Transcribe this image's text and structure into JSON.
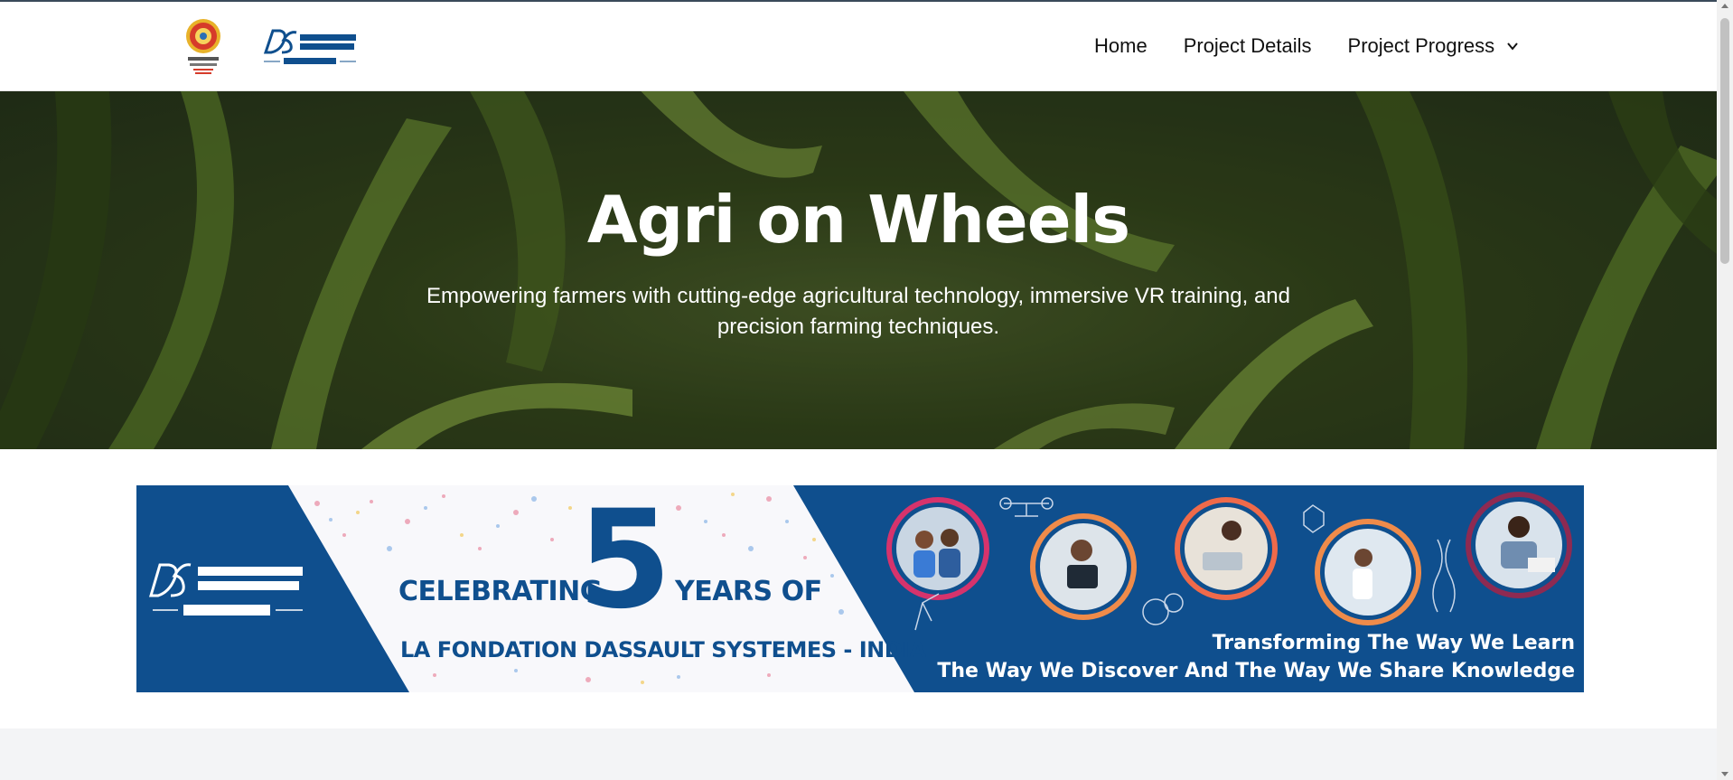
{
  "header": {
    "logos": [
      {
        "name": "Centurion University",
        "icon": "centurion-university-logo"
      },
      {
        "name": "Dassault Systemes La Fondation",
        "icon": "dassault-systemes-logo"
      }
    ],
    "nav": {
      "home": "Home",
      "project_details": "Project Details",
      "project_progress": "Project Progress"
    }
  },
  "hero": {
    "title": "Agri on Wheels",
    "subtitle": "Empowering farmers with cutting-edge agricultural technology, immersive VR training, and precision farming techniques."
  },
  "banner": {
    "celebrating": "CELEBRATING",
    "number": "5",
    "years_of": "YEARS OF",
    "fondation": "LA FONDATION DASSAULT SYSTEMES - INDIA",
    "tagline_1": "Transforming The Way We Learn",
    "tagline_2": "The Way We Discover And The Way We Share Knowledge",
    "logo_lines": [
      "DASSAULT",
      "SYSTEMES",
      "La Fondation"
    ]
  },
  "colors": {
    "brand_blue": "#0f4f8e",
    "hero_green": "#34461c",
    "gray_band": "#f3f4f6"
  }
}
